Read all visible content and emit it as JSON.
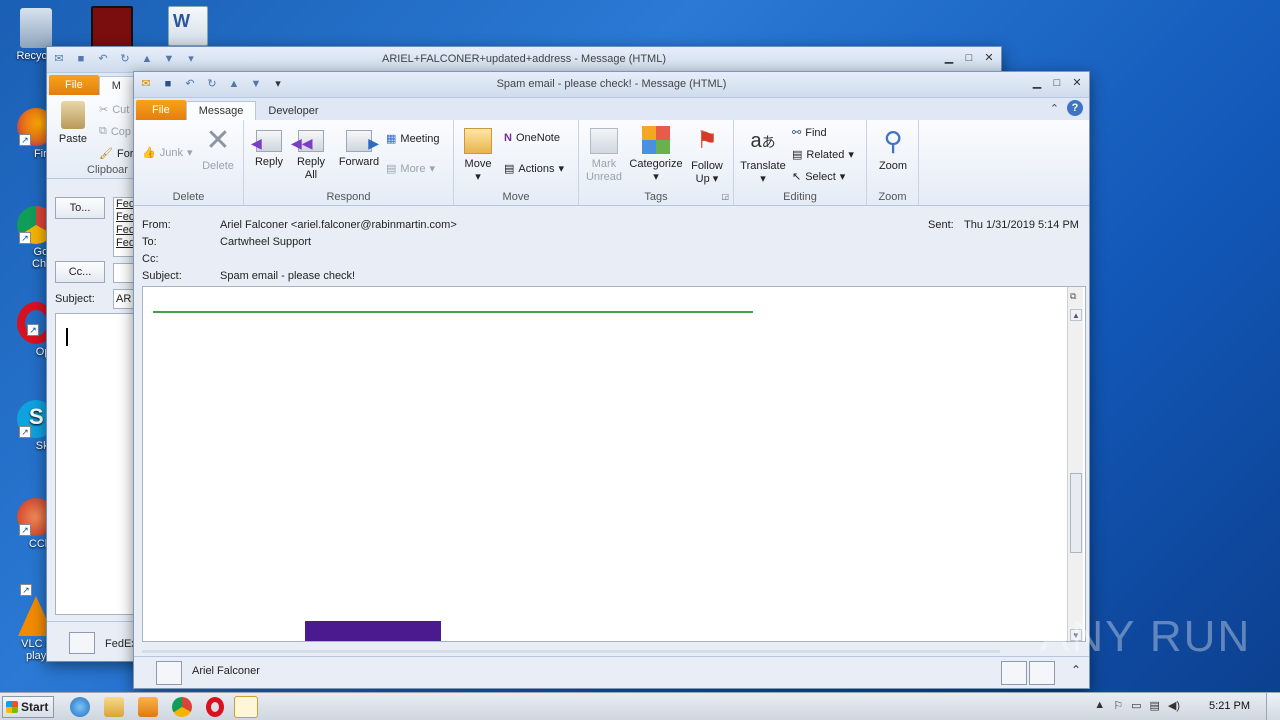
{
  "desktop": {
    "icons": [
      {
        "label": "Recycle",
        "color": "#7a8fa8"
      },
      {
        "label": "Firefo",
        "color": "#e66b1a"
      },
      {
        "label": "Goog Chron",
        "color": "#34a853"
      },
      {
        "label": "Oper",
        "color": "#d8111f"
      },
      {
        "label": "Skyp",
        "color": "#0ea2e0"
      },
      {
        "label": "CClear",
        "color": "#c8321d"
      },
      {
        "label": "VLC me player",
        "color": "#f28a00"
      }
    ]
  },
  "back_window": {
    "title": "ARIEL+FALCONER+updated+address - Message (HTML)",
    "tab_file": "File",
    "tab_message_partial": "M",
    "clipboard": {
      "paste": "Paste",
      "cut": "Cut",
      "copy": "Cop",
      "format": "For",
      "group": "Clipboar"
    },
    "to_button": "To...",
    "cc_button": "Cc...",
    "subject_label": "Subject:",
    "subject_value": "AR",
    "to_lines": [
      "Fed",
      "Fed",
      "Fed",
      "Fed"
    ],
    "people_pane_name": "FedEx"
  },
  "front_window": {
    "title": "Spam email - please check! - Message (HTML)",
    "tabs": [
      "File",
      "Message",
      "Developer"
    ],
    "ribbon": {
      "delete_group": {
        "junk": "Junk",
        "delete": "Delete",
        "label": "Delete"
      },
      "respond_group": {
        "reply": "Reply",
        "reply_all_1": "Reply",
        "reply_all_2": "All",
        "forward": "Forward",
        "meeting": "Meeting",
        "more": "More",
        "label": "Respond"
      },
      "move_group": {
        "move": "Move",
        "onenote": "OneNote",
        "actions": "Actions",
        "label": "Move"
      },
      "tags_group": {
        "mark_1": "Mark",
        "mark_2": "Unread",
        "categorize": "Categorize",
        "follow_1": "Follow",
        "follow_2": "Up",
        "label": "Tags"
      },
      "editing_group": {
        "translate": "Translate",
        "find": "Find",
        "related": "Related",
        "select": "Select",
        "label": "Editing"
      },
      "zoom_group": {
        "zoom": "Zoom",
        "label": "Zoom"
      }
    },
    "header": {
      "from_label": "From:",
      "from_value": "Ariel Falconer <ariel.falconer@rabinmartin.com>",
      "to_label": "To:",
      "to_value": "Cartwheel Support",
      "cc_label": "Cc:",
      "subject_label": "Subject:",
      "subject_value": "Spam email - please check!",
      "sent_label": "Sent:",
      "sent_value": "Thu 1/31/2019 5:14 PM"
    },
    "people_pane_name": "Ariel Falconer"
  },
  "taskbar": {
    "start_label": "Start",
    "clock": "5:21 PM"
  },
  "watermark": "ANY RUN"
}
